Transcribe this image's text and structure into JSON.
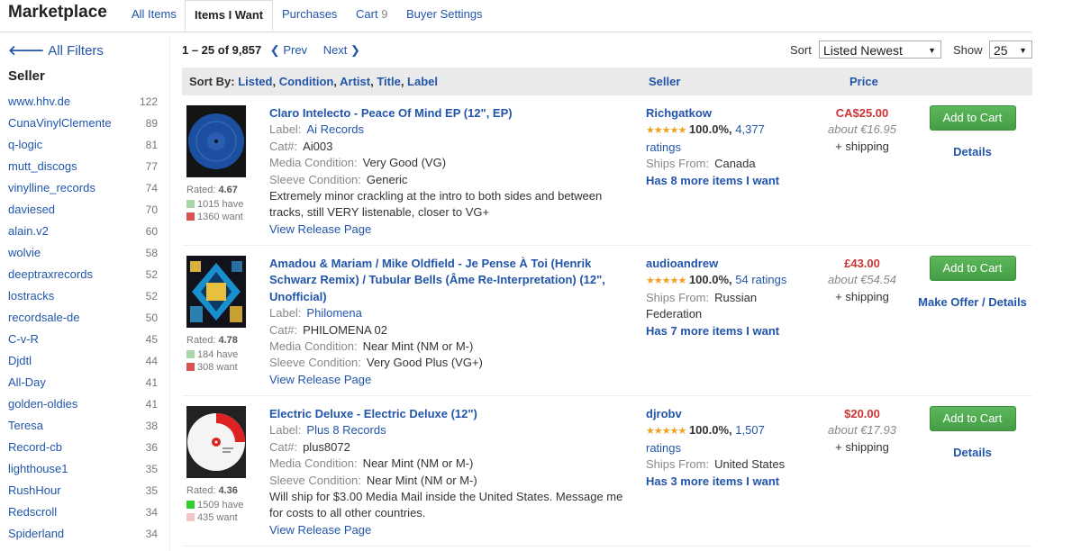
{
  "header": {
    "brand": "Marketplace",
    "tabs": [
      {
        "label": "All Items",
        "count": ""
      },
      {
        "label": "Items I Want",
        "count": ""
      },
      {
        "label": "Purchases",
        "count": ""
      },
      {
        "label": "Cart",
        "count": "9"
      },
      {
        "label": "Buyer Settings",
        "count": ""
      }
    ]
  },
  "sidebar": {
    "all_filters": "All Filters",
    "seller_heading": "Seller",
    "sellers": [
      {
        "name": "www.hhv.de",
        "count": "122"
      },
      {
        "name": "CunaVinylClemente",
        "count": "89"
      },
      {
        "name": "q-logic",
        "count": "81"
      },
      {
        "name": "mutt_discogs",
        "count": "77"
      },
      {
        "name": "vinylline_records",
        "count": "74"
      },
      {
        "name": "daviesed",
        "count": "70"
      },
      {
        "name": "alain.v2",
        "count": "60"
      },
      {
        "name": "wolvie",
        "count": "58"
      },
      {
        "name": "deeptraxrecords",
        "count": "52"
      },
      {
        "name": "lostracks",
        "count": "52"
      },
      {
        "name": "recordsale-de",
        "count": "50"
      },
      {
        "name": "C-v-R",
        "count": "45"
      },
      {
        "name": "Djdtl",
        "count": "44"
      },
      {
        "name": "All-Day",
        "count": "41"
      },
      {
        "name": "golden-oldies",
        "count": "41"
      },
      {
        "name": "Teresa",
        "count": "38"
      },
      {
        "name": "Record-cb",
        "count": "36"
      },
      {
        "name": "lighthouse1",
        "count": "35"
      },
      {
        "name": "RushHour",
        "count": "35"
      },
      {
        "name": "Redscroll",
        "count": "34"
      },
      {
        "name": "Spiderland",
        "count": "34"
      }
    ]
  },
  "results": {
    "range": "1 – 25 of 9,857",
    "prev": "Prev",
    "next": "Next",
    "sort_label": "Sort",
    "sort_value": "Listed Newest",
    "show_label": "Show",
    "show_value": "25"
  },
  "table_header": {
    "sort_by": "Sort By:",
    "sort_links": [
      "Listed",
      "Condition",
      "Artist",
      "Title",
      "Label"
    ],
    "seller_col": "Seller",
    "price_col": "Price"
  },
  "labels": {
    "label": "Label:",
    "cat": "Cat#:",
    "media": "Media Condition:",
    "sleeve": "Sleeve Condition:",
    "view_release": "View Release Page",
    "rated": "Rated:",
    "ships_from": "Ships From:",
    "add_to_cart": "Add to Cart"
  },
  "rows": [
    {
      "title": "Claro Intelecto - Peace Of Mind EP (12\", EP)",
      "label": "Ai Records",
      "cat": "Ai003",
      "media": "Very Good (VG)",
      "sleeve": "Generic",
      "comment": "Extremely minor crackling at the intro to both sides and between tracks, still VERY listenable, closer to VG+",
      "rating": "4.67",
      "have": "1015 have",
      "want": "1360 want",
      "have_color": "#a8d8a8",
      "want_color": "#d9534f",
      "seller": "Richgatkow",
      "pct": "100.0%,",
      "ratings_count": "4,377",
      "ratings_word": "ratings",
      "ships_from": "Canada",
      "more": "Has 8 more items I want",
      "price": "CA$25.00",
      "about": "about €16.95",
      "shipping": "+ shipping",
      "details": "Details"
    },
    {
      "title": "Amadou & Mariam / Mike Oldfield - Je Pense À Toi (Henrik Schwarz Remix) / Tubular Bells (Âme Re-Interpretation) (12\", Unofficial)",
      "label": "Philomena",
      "cat": "PHILOMENA 02",
      "media": "Near Mint (NM or M-)",
      "sleeve": "Very Good Plus (VG+)",
      "comment": "",
      "rating": "4.78",
      "have": "184 have",
      "want": "308 want",
      "have_color": "#a8d8a8",
      "want_color": "#d9534f",
      "seller": "audioandrew",
      "pct": "100.0%,",
      "ratings_count": "54 ratings",
      "ratings_word": "",
      "ships_from": "Russian Federation",
      "more": "Has 7 more items I want",
      "price": "£43.00",
      "about": "about €54.54",
      "shipping": "+ shipping",
      "details": "Make Offer / Details"
    },
    {
      "title": "Electric Deluxe - Electric Deluxe (12\")",
      "label": "Plus 8 Records",
      "cat": "plus8072",
      "media": "Near Mint (NM or M-)",
      "sleeve": "Near Mint (NM or M-)",
      "comment": "Will ship for $3.00 Media Mail inside the United States. Message me for costs to all other countries.",
      "rating": "4.36",
      "have": "1509 have",
      "want": "435 want",
      "have_color": "#33cc33",
      "want_color": "#f2c6c6",
      "seller": "djrobv",
      "pct": "100.0%,",
      "ratings_count": "1,507",
      "ratings_word": "ratings",
      "ships_from": "United States",
      "more": "Has 3 more items I want",
      "price": "$20.00",
      "about": "about €17.93",
      "shipping": "+ shipping",
      "details": "Details"
    }
  ]
}
